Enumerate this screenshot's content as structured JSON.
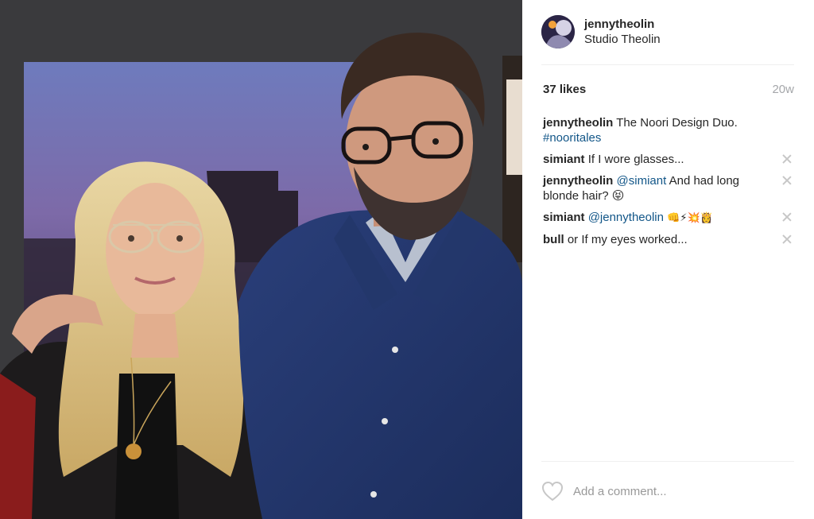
{
  "post": {
    "photo_icon": "photo-two-people",
    "author": {
      "username": "jennytheolin",
      "location": "Studio Theolin",
      "avatar_icon": "avatar-icon"
    },
    "likes_label": "37 likes",
    "age_label": "20w",
    "caption": {
      "user": "jennytheolin",
      "text": "The Noori Design Duo.",
      "hashtag": "#nooritales"
    },
    "comments": [
      {
        "user": "simiant",
        "mention": "",
        "text": "If I wore glasses..."
      },
      {
        "user": "jennytheolin",
        "mention": "@simiant",
        "text": "And had long blonde hair? 😝"
      },
      {
        "user": "simiant",
        "mention": "@jennytheolin",
        "text": "👊⚡💥👸"
      },
      {
        "user": "bull",
        "mention": "",
        "text": "or If my eyes worked..."
      }
    ],
    "add_comment_placeholder": "Add a comment...",
    "colors": {
      "link": "#125688",
      "muted": "#a5a7aa",
      "divider": "#efefef",
      "text": "#262626"
    }
  }
}
